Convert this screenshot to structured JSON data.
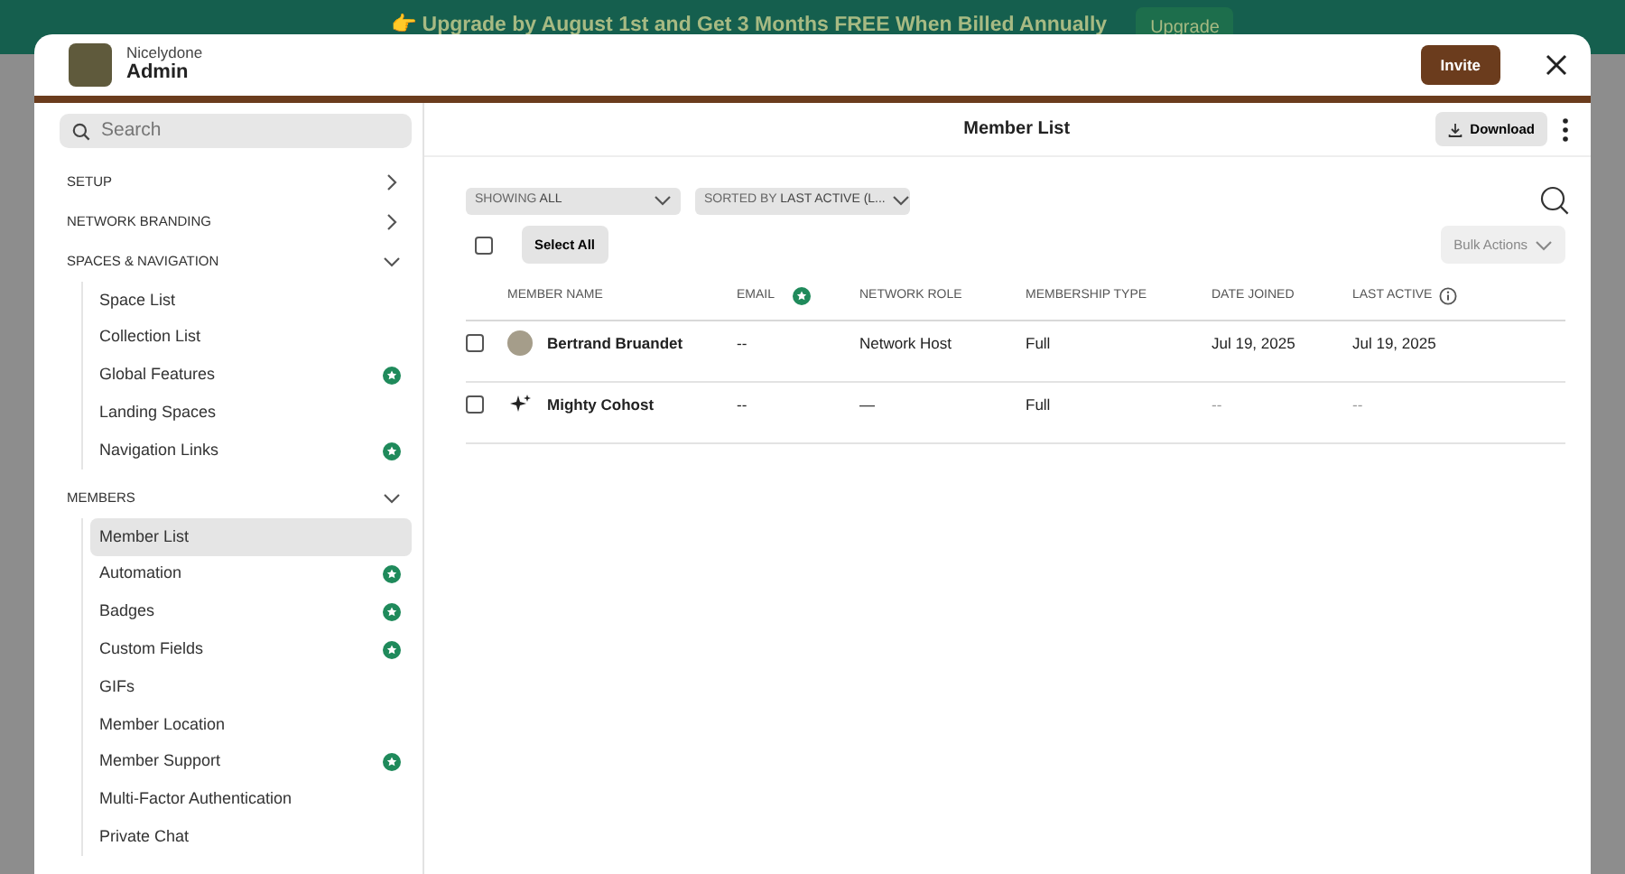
{
  "banner": {
    "text": "👉 Upgrade by August 1st and Get 3 Months FREE When Billed Annually",
    "button": "Upgrade"
  },
  "modal": {
    "org_name": "Nicelydone",
    "title": "Admin",
    "invite_button": "Invite"
  },
  "sidebar": {
    "search": {
      "placeholder": "Search"
    },
    "sections": [
      {
        "label": "SETUP",
        "expanded": false
      },
      {
        "label": "NETWORK BRANDING",
        "expanded": false
      },
      {
        "label": "SPACES & NAVIGATION",
        "expanded": true,
        "items": [
          {
            "label": "Space List",
            "selected": false,
            "premium": false
          },
          {
            "label": "Collection List",
            "selected": false,
            "premium": false
          },
          {
            "label": "Global Features",
            "selected": false,
            "premium": true
          },
          {
            "label": "Landing Spaces",
            "selected": false,
            "premium": false
          },
          {
            "label": "Navigation Links",
            "selected": false,
            "premium": true
          }
        ]
      },
      {
        "label": "MEMBERS",
        "expanded": true,
        "items": [
          {
            "label": "Member List",
            "selected": true,
            "premium": false
          },
          {
            "label": "Automation",
            "selected": false,
            "premium": true
          },
          {
            "label": "Badges",
            "selected": false,
            "premium": true
          },
          {
            "label": "Custom Fields",
            "selected": false,
            "premium": true
          },
          {
            "label": "GIFs",
            "selected": false,
            "premium": false
          },
          {
            "label": "Member Location",
            "selected": false,
            "premium": false
          },
          {
            "label": "Member Support",
            "selected": false,
            "premium": true
          },
          {
            "label": "Multi-Factor Authentication",
            "selected": false,
            "premium": false
          },
          {
            "label": "Private Chat",
            "selected": false,
            "premium": false
          }
        ]
      }
    ]
  },
  "main": {
    "title": "Member List",
    "download_button": "Download",
    "filters": [
      {
        "prefix": "SHOWING",
        "value": "ALL"
      },
      {
        "prefix": "SORTED BY",
        "value": "LAST ACTIVE (L..."
      }
    ],
    "select_all": {
      "label": "Select All",
      "checked": false
    },
    "bulk_actions": "Bulk Actions",
    "columns": [
      {
        "label": "MEMBER NAME",
        "kind": "plain"
      },
      {
        "label": "EMAIL",
        "kind": "premium"
      },
      {
        "label": "NETWORK ROLE",
        "kind": "plain"
      },
      {
        "label": "MEMBERSHIP TYPE",
        "kind": "plain"
      },
      {
        "label": "DATE JOINED",
        "kind": "plain"
      },
      {
        "label": "LAST ACTIVE",
        "kind": "info"
      }
    ],
    "rows": [
      {
        "checked": false,
        "kind": "photo",
        "name": "Bertrand Bruandet",
        "email": "--",
        "role": "Network Host",
        "type": "Full",
        "joined": "Jul 19, 2025",
        "last_active": "Jul 19, 2025"
      },
      {
        "checked": false,
        "kind": "sparkle",
        "name": "Mighty Cohost",
        "email": "--",
        "role": "—",
        "type": "Full",
        "joined": "--",
        "last_active": "--"
      }
    ]
  }
}
